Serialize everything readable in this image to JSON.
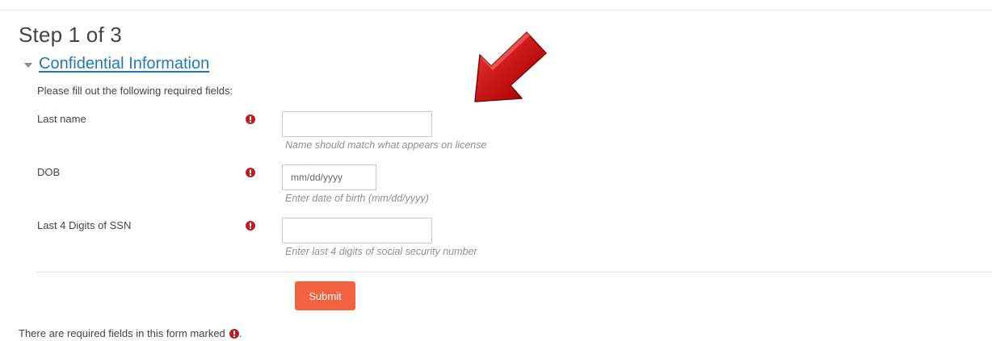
{
  "page": {
    "step_title": "Step 1 of 3",
    "section_title": "Confidential Information",
    "intro": "Please fill out the following required fields:"
  },
  "fields": {
    "last_name": {
      "label": "Last name",
      "value": "",
      "placeholder": "",
      "help": "Name should match what appears on license"
    },
    "dob": {
      "label": "DOB",
      "value": "",
      "placeholder": "mm/dd/yyyy",
      "help": "Enter date of birth (mm/dd/yyyy)"
    },
    "ssn": {
      "label": "Last 4 Digits of SSN",
      "value": "",
      "placeholder": "",
      "help": "Enter last 4 digits of social security number"
    }
  },
  "actions": {
    "submit_label": "Submit"
  },
  "footer": {
    "required_note": "There are required fields in this form marked",
    "required_note_end": "."
  },
  "icons": {
    "required": "exclamation-circle-icon",
    "section_toggle": "caret-down-icon",
    "annotation": "red-arrow"
  },
  "colors": {
    "link": "#1f7ab5",
    "required_icon": "#b81f1f",
    "submit_bg": "#f2623f",
    "arrow": "#d11a1a",
    "help_text": "#909090"
  }
}
